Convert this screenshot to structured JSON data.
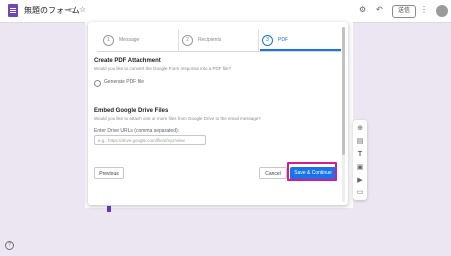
{
  "header": {
    "title": "無題のフォーム",
    "share_label": "送信"
  },
  "dialog": {
    "steps": [
      {
        "num": "1",
        "label": "Message"
      },
      {
        "num": "2",
        "label": "Recipients"
      },
      {
        "num": "3",
        "label": "PDF"
      }
    ],
    "pdf_section": {
      "title": "Create PDF Attachment",
      "description": "Would you like to convert the Google Form response into a PDF file?",
      "radio_label": "Generate PDF file"
    },
    "drive_section": {
      "title": "Embed Google Drive Files",
      "description": "Would you like to attach one or more files from Google Drive to the email message?",
      "field_label": "Enter Drive URLs (comma separated):",
      "placeholder": "e.g., https://drive.google.com/file/d/xyz/view"
    },
    "buttons": {
      "previous": "Previous",
      "cancel": "Cancel",
      "save": "Save & Continue"
    }
  },
  "colors": {
    "accent": "#1a73e8",
    "highlight": "#d81b8c",
    "forms_purple": "#673ab7",
    "background": "#ebe6f2"
  },
  "icons": {
    "side_toolbar": [
      "add-circle-icon",
      "import-icon",
      "title-icon",
      "image-icon",
      "video-icon",
      "section-icon"
    ]
  }
}
